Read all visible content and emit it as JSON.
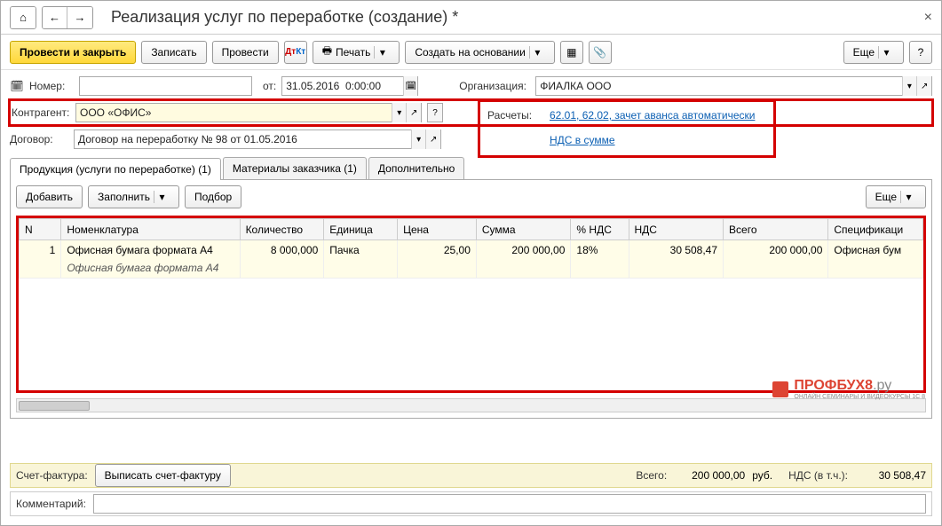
{
  "title": "Реализация услуг по переработке (создание) *",
  "toolbar": {
    "post_close": "Провести и закрыть",
    "save": "Записать",
    "post": "Провести",
    "print": "Печать",
    "create_based": "Создать на основании",
    "more": "Еще"
  },
  "header": {
    "number_label": "Номер:",
    "number_value": "",
    "date_label": "от:",
    "date_value": "31.05.2016  0:00:00",
    "org_label": "Организация:",
    "org_value": "ФИАЛКА ООО",
    "counterparty_label": "Контрагент:",
    "counterparty_value": "ООО «ОФИС»",
    "contract_label": "Договор:",
    "contract_value": "Договор на переработку № 98 от 01.05.2016",
    "calc_label": "Расчеты:",
    "calc_link": "62.01, 62.02, зачет аванса автоматически",
    "vat_link": "НДС в сумме"
  },
  "tabs": {
    "t1": "Продукция (услуги по переработке) (1)",
    "t2": "Материалы заказчика (1)",
    "t3": "Дополнительно"
  },
  "tab_toolbar": {
    "add": "Добавить",
    "fill": "Заполнить",
    "select": "Подбор",
    "more": "Еще"
  },
  "grid": {
    "cols": {
      "n": "N",
      "nom": "Номенклатура",
      "qty": "Количество",
      "unit": "Единица",
      "price": "Цена",
      "sum": "Сумма",
      "vat_pct": "% НДС",
      "vat": "НДС",
      "total": "Всего",
      "spec": "Спецификаци"
    },
    "rows": [
      {
        "n": "1",
        "nom": "Офисная бумага формата А4",
        "nom_sub": "Офисная бумага формата А4",
        "qty": "8 000,000",
        "unit": "Пачка",
        "price": "25,00",
        "sum": "200 000,00",
        "vat_pct": "18%",
        "vat": "30 508,47",
        "total": "200 000,00",
        "spec": "Офисная бум"
      }
    ]
  },
  "watermark": {
    "main": "ПРОФБУХ8",
    "suffix": ".ру",
    "sub": "ОНЛАЙН СЕМИНАРЫ И ВИДЕОКУРСЫ 1С 8"
  },
  "footer": {
    "invoice_label": "Счет-фактура:",
    "invoice_btn": "Выписать счет-фактуру",
    "total_label": "Всего:",
    "total_value": "200 000,00",
    "currency": "руб.",
    "vat_label": "НДС (в т.ч.):",
    "vat_value": "30 508,47",
    "comment_label": "Комментарий:",
    "comment_value": ""
  }
}
